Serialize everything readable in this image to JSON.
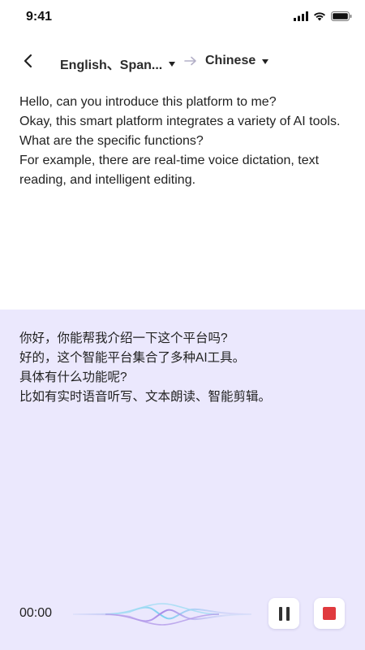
{
  "status_bar": {
    "time": "9:41"
  },
  "header": {
    "source_language": "English、Span...",
    "target_language": "Chinese"
  },
  "source_lines": [
    "Hello, can you introduce this platform to me?",
    "Okay, this smart platform integrates a variety of AI tools.",
    "What are the specific functions?",
    "For example, there are real-time voice dictation, text reading, and intelligent editing."
  ],
  "translation_lines": [
    "你好，你能帮我介绍一下这个平台吗?",
    "好的，这个智能平台集合了多种AI工具。",
    "具体有什么功能呢?",
    "比如有实时语音听写、文本朗读、智能剪辑。"
  ],
  "recording": {
    "timer": "00:00"
  },
  "colors": {
    "panel_background": "#ebe8fd",
    "stop_accent": "#e03a3e"
  },
  "icons": [
    "signal-icon",
    "wifi-icon",
    "battery-icon",
    "back-arrow-icon",
    "caret-down-icon",
    "arrow-right-icon",
    "waveform-icon",
    "pause-icon",
    "stop-icon"
  ]
}
